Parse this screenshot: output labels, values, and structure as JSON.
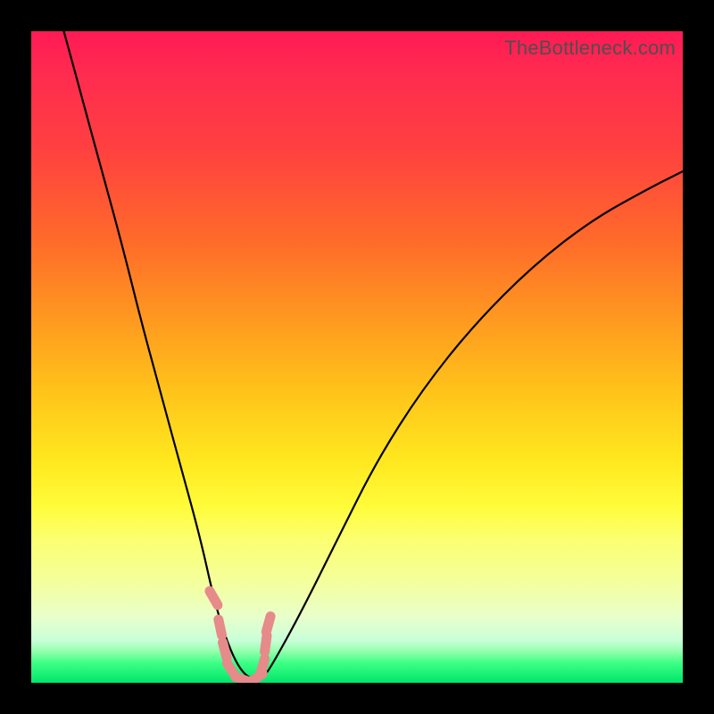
{
  "watermark": "TheBottleneck.com",
  "chart_data": {
    "type": "line",
    "title": "",
    "xlabel": "",
    "ylabel": "",
    "xlim": [
      0,
      100
    ],
    "ylim": [
      0,
      100
    ],
    "x": [
      5,
      8,
      11,
      14,
      17,
      20,
      23,
      26,
      28,
      29.5,
      31,
      32.5,
      34,
      35,
      36,
      41,
      47,
      53,
      60,
      68,
      77,
      86,
      95,
      100
    ],
    "values": [
      100,
      89,
      78,
      67,
      55,
      44,
      33,
      22,
      13,
      8,
      4,
      1.5,
      0.5,
      0.5,
      1,
      10,
      22,
      34,
      45,
      55,
      64,
      71,
      76,
      78.5
    ],
    "series_name": "bottleneck-curve",
    "markers": {
      "color": "#e68a8a",
      "style": "segment",
      "points_x": [
        28.0,
        29.0,
        29.7,
        30.7,
        32.5,
        34.5,
        35.5,
        36.0,
        36.4
      ],
      "points_y": [
        13.0,
        8.5,
        5.0,
        2.0,
        0.5,
        0.7,
        2.5,
        6.0,
        9.0
      ]
    },
    "background": "red-yellow-green vertical gradient"
  }
}
